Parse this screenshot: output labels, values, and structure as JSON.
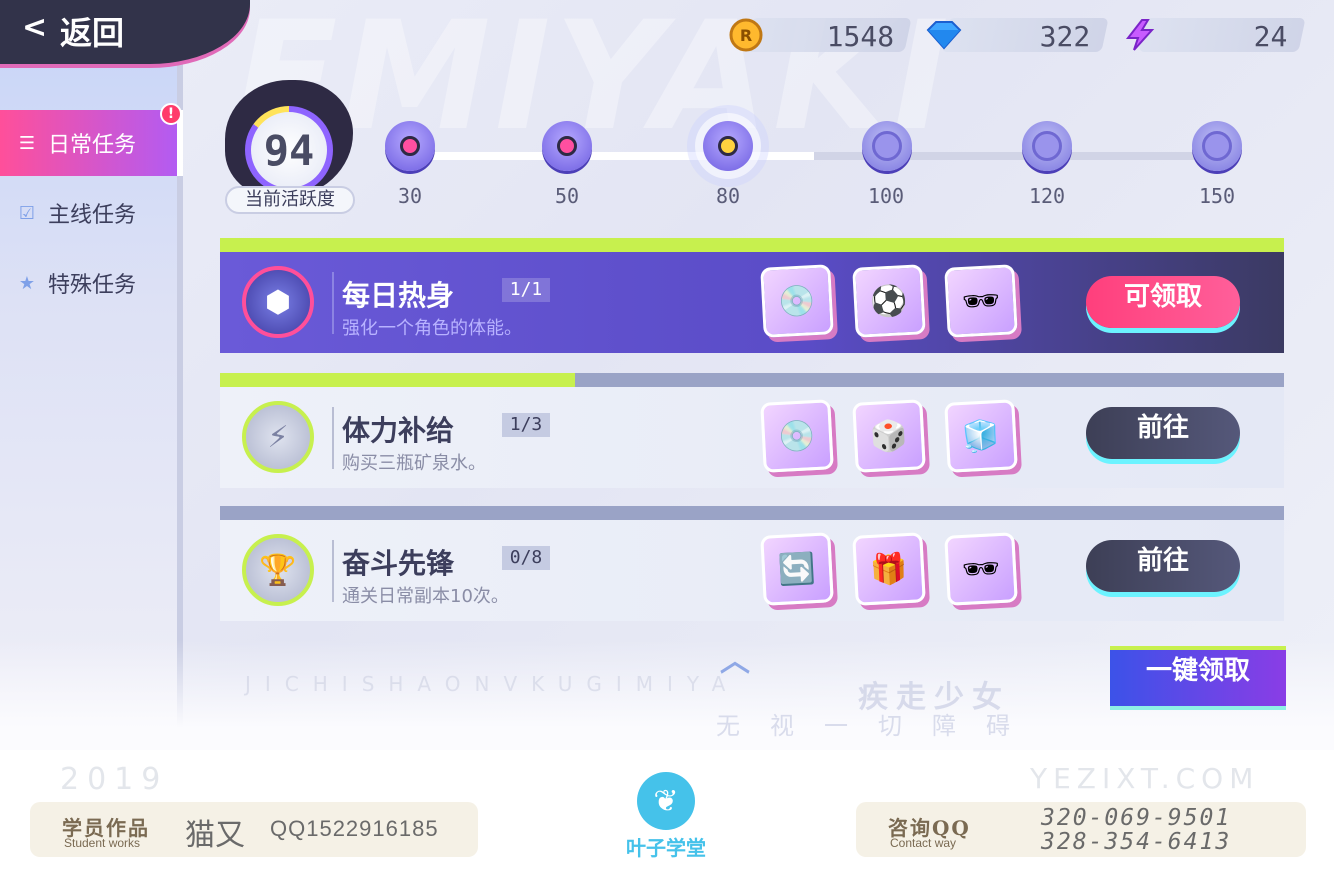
{
  "header": {
    "back_label": "返回",
    "back_icon": "arrow-left-icon",
    "watermark": "EMIYAKI"
  },
  "currencies": [
    {
      "name": "coin",
      "icon": "coin-icon",
      "value": "1548"
    },
    {
      "name": "diamond",
      "icon": "diamond-icon",
      "value": "322"
    },
    {
      "name": "energy",
      "icon": "lightning-icon",
      "value": "24"
    }
  ],
  "sidebar": {
    "badge": "!",
    "tabs": [
      {
        "label": "日常任务",
        "icon": "list-icon",
        "active": true
      },
      {
        "label": "主线任务",
        "icon": "clipboard-check-icon",
        "active": false
      },
      {
        "label": "特殊任务",
        "icon": "star-flag-icon",
        "active": false
      }
    ]
  },
  "activity": {
    "value": "94",
    "label": "当前活跃度",
    "milestones": [
      {
        "label": "30",
        "state": "reached"
      },
      {
        "label": "50",
        "state": "reached"
      },
      {
        "label": "80",
        "state": "current"
      },
      {
        "label": "100",
        "state": "locked"
      },
      {
        "label": "120",
        "state": "locked"
      },
      {
        "label": "150",
        "state": "locked"
      }
    ],
    "bar_fraction": 0.5
  },
  "tasks": [
    {
      "name": "每日热身",
      "progress": "1/1",
      "fraction": 1.0,
      "desc": "强化一个角色的体能。",
      "icon": "dumbbell-icon",
      "rewards": [
        "disc-icon",
        "soccer-ball-icon",
        "sunglasses-icon"
      ],
      "button": "可领取",
      "state": "claimable"
    },
    {
      "name": "体力补给",
      "progress": "1/3",
      "fraction": 0.3333,
      "desc": "购买三瓶矿泉水。",
      "icon": "energy-plus-icon",
      "rewards": [
        "disc-icon",
        "cube-icon",
        "rubiks-cube-icon"
      ],
      "button": "前往",
      "state": "in-progress"
    },
    {
      "name": "奋斗先锋",
      "progress": "0/8",
      "fraction": 0.0,
      "desc": "通关日常副本10次。",
      "icon": "trophy-icon",
      "rewards": [
        "refresh-arrows-icon",
        "mystery-box-icon",
        "sunglasses-icon"
      ],
      "button": "前往",
      "state": "in-progress"
    }
  ],
  "footer_game": {
    "claim_all": "一键领取",
    "pinyin": "JICHISHAONVKUGIMIYA",
    "slogan_title": "疾走少女",
    "slogan_sub": "无视一切障碍"
  },
  "credits": {
    "year": "2019",
    "site": "YEZIXT.COM",
    "works_label": "学员作品",
    "works_label_en": "Student works",
    "author": "猫又",
    "author_qq": "QQ1522916185",
    "logo_text": "叶子学堂",
    "contact_label": "咨询QQ",
    "contact_label_en": "Contact way",
    "phone1": "320-069-9501",
    "phone2": "328-354-6413"
  },
  "colors": {
    "accent_pink": "#ff4f9a",
    "accent_purple": "#6a5ad8",
    "accent_lime": "#c7f04e",
    "accent_cyan": "#6cf3ff"
  }
}
